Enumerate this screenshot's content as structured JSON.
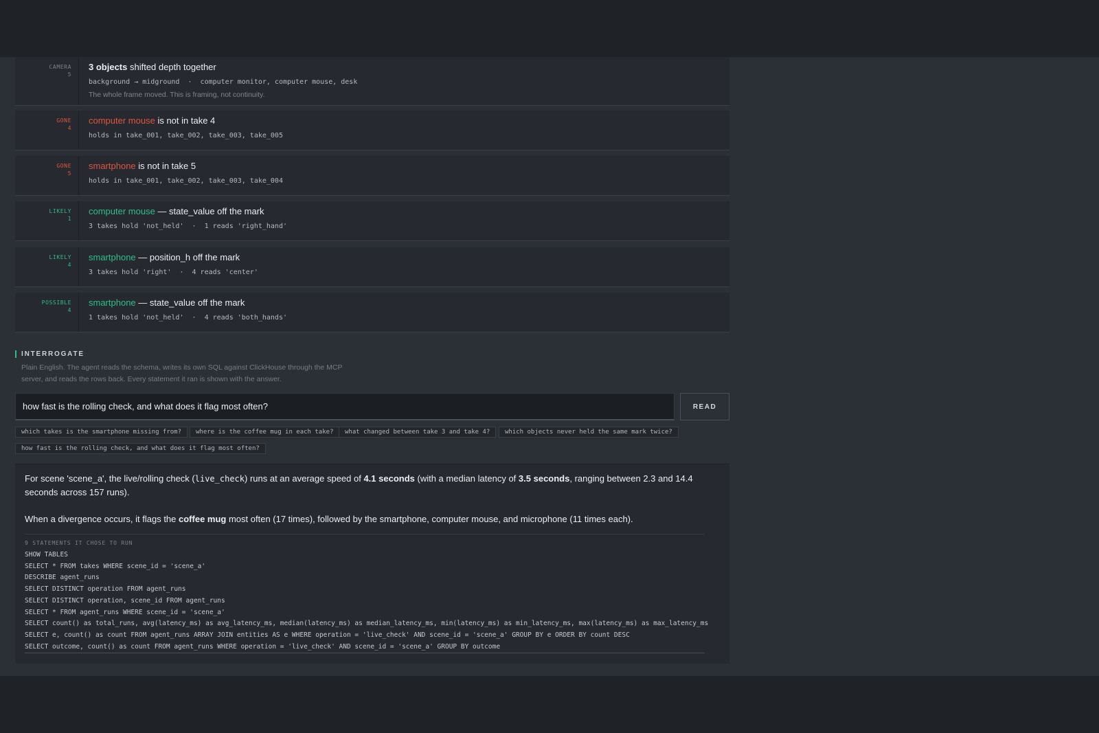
{
  "cards": [
    {
      "tag": "CAMERA",
      "tag_count": "5",
      "title_strong": "3 objects",
      "title_rest": " shifted depth together",
      "detail": "background → midground  ·  computer monitor, computer mouse, desk",
      "note": "The whole frame moved. This is framing, not continuity."
    },
    {
      "tag": "GONE",
      "tag_count": "4",
      "entity": "computer mouse",
      "title_rest": " is not in take 4",
      "detail": "holds in take_001, take_002, take_003, take_005"
    },
    {
      "tag": "GONE",
      "tag_count": "5",
      "entity": "smartphone",
      "title_rest": " is not in take 5",
      "detail": "holds in take_001, take_002, take_003, take_004"
    },
    {
      "tag": "LIKELY",
      "tag_count": "1",
      "entity": "computer mouse",
      "title_rest": " — state_value off the mark",
      "detail": "3 takes hold 'not_held'  ·  1 reads 'right_hand'"
    },
    {
      "tag": "LIKELY",
      "tag_count": "4",
      "entity": "smartphone",
      "title_rest": " — position_h off the mark",
      "detail": "3 takes hold 'right'  ·  4 reads 'center'"
    },
    {
      "tag": "POSSIBLE",
      "tag_count": "4",
      "entity": "smartphone",
      "title_rest": " — state_value off the mark",
      "detail": "1 takes hold 'not_held'  ·  4 reads 'both_hands'"
    }
  ],
  "interrogate": {
    "heading": "INTERROGATE",
    "description": "Plain English. The agent reads the schema, writes its own SQL against ClickHouse through the MCP server, and reads the rows back. Every statement it ran is shown with the answer.",
    "query_value": "how fast is the rolling check, and what does it flag most often?",
    "read_label": "READ",
    "suggestions": [
      "which takes is the smartphone missing from?",
      "where is the coffee mug in each take?",
      "what changed between take 3 and take 4?",
      "which objects never held the same mark twice?",
      "how fast is the rolling check, and what does it flag most often?"
    ]
  },
  "answer": {
    "p1_a": "For scene 'scene_a', the live/rolling check (",
    "p1_code": "live_check",
    "p1_b": ") runs at an average speed of ",
    "p1_strong1": "4.1 seconds",
    "p1_c": " (with a median latency of ",
    "p1_strong2": "3.5 seconds",
    "p1_d": ", ranging between 2.3 and 14.4 seconds across 157 runs).",
    "p2_a": "When a divergence occurs, it flags the ",
    "p2_strong": "coffee mug",
    "p2_b": " most often (17 times), followed by the smartphone, computer mouse, and microphone (11 times each).",
    "statements_heading": "9 STATEMENTS IT CHOSE TO RUN",
    "statements": [
      "SHOW TABLES",
      "SELECT * FROM takes WHERE scene_id = 'scene_a'",
      "DESCRIBE agent_runs",
      "SELECT DISTINCT operation FROM agent_runs",
      "SELECT DISTINCT operation, scene_id FROM agent_runs",
      "SELECT * FROM agent_runs WHERE scene_id = 'scene_a'",
      "SELECT count() as total_runs, avg(latency_ms) as avg_latency_ms, median(latency_ms) as median_latency_ms, min(latency_ms) as min_latency_ms, max(latency_ms) as max_latency_ms F",
      "SELECT e, count() as count FROM agent_runs ARRAY JOIN entities AS e WHERE operation = 'live_check' AND scene_id = 'scene_a' GROUP BY e ORDER BY count DESC",
      "SELECT outcome, count() as count FROM agent_runs WHERE operation = 'live_check' AND scene_id = 'scene_a' GROUP BY outcome"
    ]
  },
  "colors": {
    "gone": "#e0543c",
    "likely": "#2fbf86",
    "background": "#2b2f36",
    "chrome": "#1f2226"
  }
}
